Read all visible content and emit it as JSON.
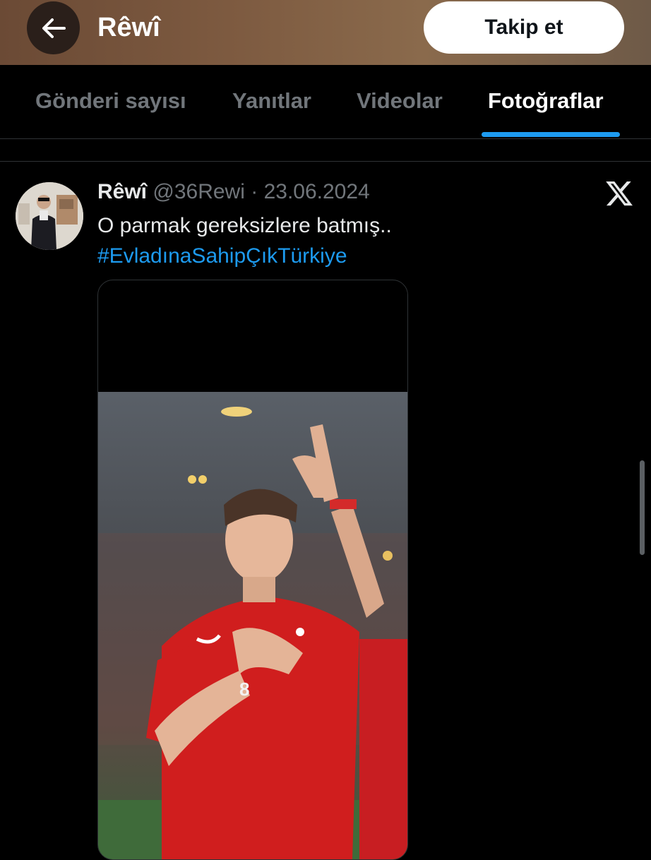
{
  "header": {
    "title": "Rêwî",
    "follow_label": "Takip et",
    "back_icon": "arrow-left-icon"
  },
  "tabs": [
    {
      "label": "Gönderi sayısı",
      "active": false
    },
    {
      "label": "Yanıtlar",
      "active": false
    },
    {
      "label": "Videolar",
      "active": false
    },
    {
      "label": "Fotoğraflar",
      "active": true
    }
  ],
  "tweet": {
    "name": "Rêwî",
    "handle": "@36Rewi",
    "separator": "·",
    "date": "23.06.2024",
    "text": "O parmak gereksizlere batmış..",
    "hashtag": "#EvladınaSahipÇıkTürkiye",
    "logo_icon": "x-logo-icon"
  },
  "colors": {
    "accent": "#1d9bf0",
    "background": "#000000",
    "text": "#e7e9ea",
    "muted": "#71767b",
    "jersey": "#d01e1e"
  }
}
